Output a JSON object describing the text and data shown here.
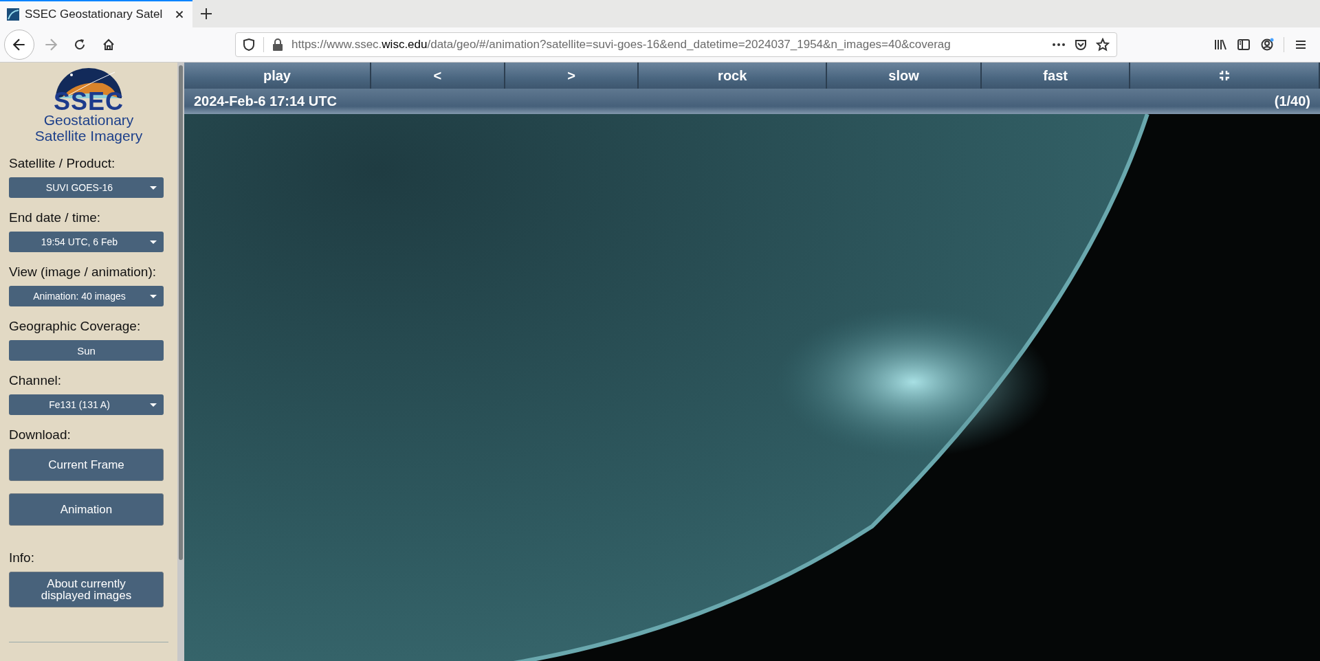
{
  "browser": {
    "tabs": [
      {
        "title": "SSEC Geostationary Satel",
        "selected": true
      }
    ],
    "nav": {
      "back_enabled": true,
      "forward_enabled": false
    },
    "url": "https://www.ssec.**wisc.edu**/data/geo/#/animation?satellite=suvi-goes-16&end_datetime=2024037_1954&n_images=40&coverag"
  },
  "sidebar": {
    "logo_text": "SSEC",
    "title_lines": [
      "Geostationary",
      "Satellite Imagery"
    ],
    "sections": [
      {
        "label": "Satellite / Product:",
        "controls": [
          {
            "kind": "dropdown",
            "text": "SUVI GOES-16"
          }
        ]
      },
      {
        "label": "End date / time:",
        "controls": [
          {
            "kind": "dropdown",
            "text": "19:54 UTC, 6 Feb"
          }
        ]
      },
      {
        "label": "View (image / animation):",
        "controls": [
          {
            "kind": "dropdown",
            "text": "Animation: 40 images"
          }
        ]
      },
      {
        "label": "Geographic Coverage:",
        "controls": [
          {
            "kind": "button",
            "text": "Sun"
          }
        ]
      },
      {
        "label": "Channel:",
        "controls": [
          {
            "kind": "dropdown",
            "text": "Fe131 (131 A)"
          }
        ]
      },
      {
        "label": "Download:",
        "controls": [
          {
            "kind": "large_button",
            "text": "Current Frame"
          },
          {
            "kind": "large_button",
            "text": "Animation"
          }
        ]
      },
      {
        "label": "Info:",
        "controls": [
          {
            "kind": "large_button",
            "text": "About currently displayed images"
          }
        ]
      }
    ]
  },
  "toolbar": [
    {
      "kind": "text",
      "label": "play"
    },
    {
      "kind": "text",
      "label": "<"
    },
    {
      "kind": "text",
      "label": ">"
    },
    {
      "kind": "text",
      "label": "rock"
    },
    {
      "kind": "text",
      "label": "slow"
    },
    {
      "kind": "text",
      "label": "fast"
    },
    {
      "kind": "fullscreen"
    }
  ],
  "frame_bar": {
    "datetime": "2024-Feb-6 17:14 UTC",
    "counter": "(1/40)"
  }
}
